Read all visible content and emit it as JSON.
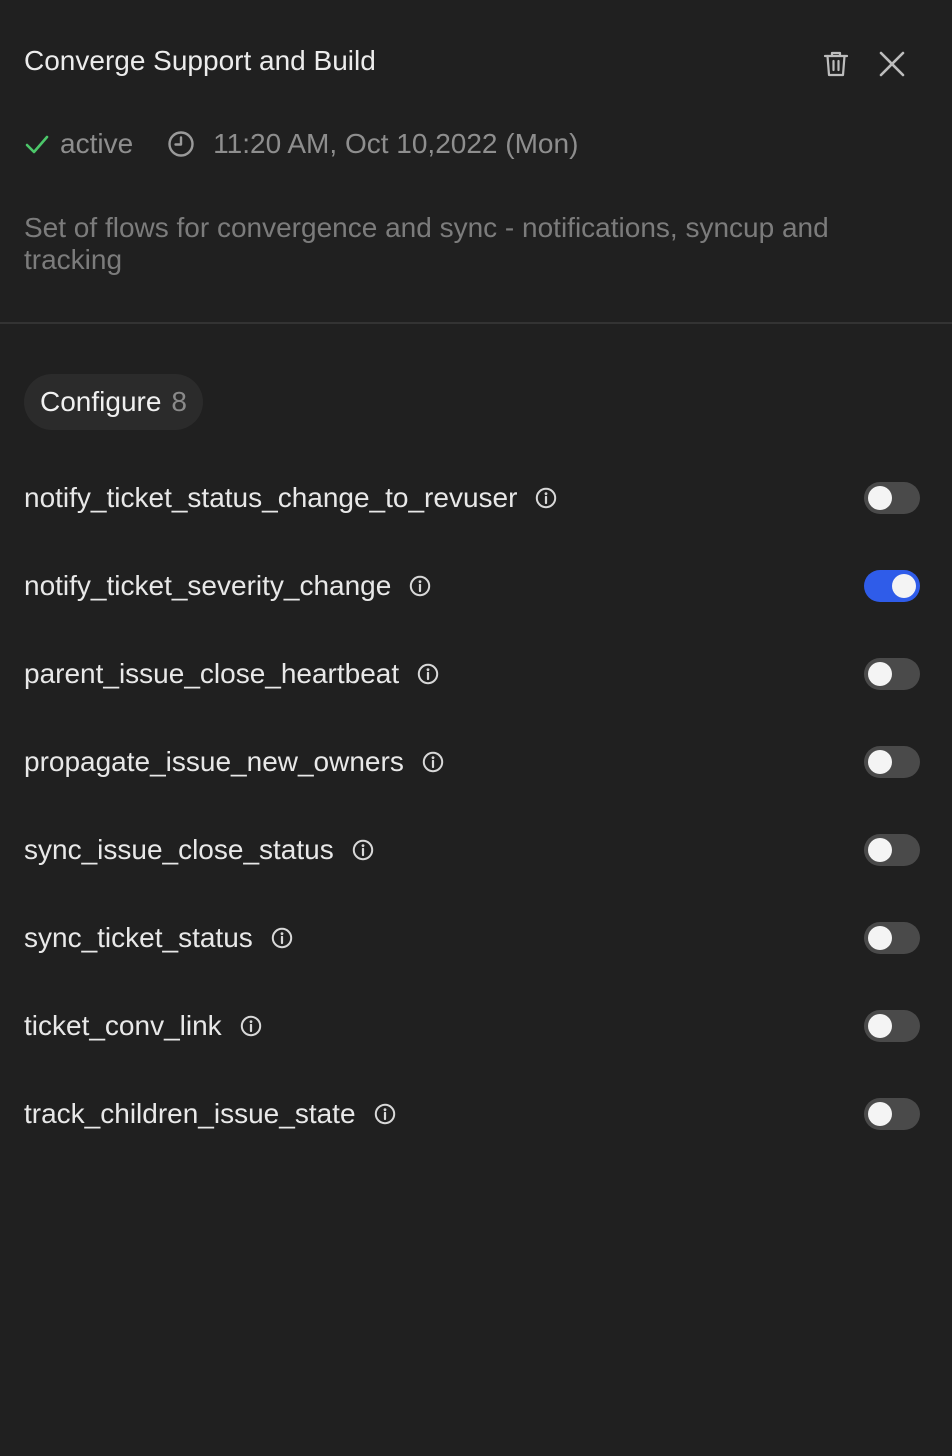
{
  "panel": {
    "title": "Converge Support and Build",
    "status": "active",
    "timestamp": "11:20 AM, Oct 10,2022 (Mon)",
    "description": "Set of flows for convergence and sync - notifications, syncup and tracking"
  },
  "icons": {
    "delete": "trash-icon",
    "close": "close-icon",
    "status": "check-icon",
    "time": "clock-icon",
    "info": "info-icon"
  },
  "colors": {
    "status_ok": "#4cc76a",
    "toggle_on": "#2f5ce9",
    "toggle_off": "#4a4a4a"
  },
  "configure": {
    "label": "Configure",
    "count": "8"
  },
  "flows": [
    {
      "name": "notify_ticket_status_change_to_revuser",
      "enabled": false
    },
    {
      "name": "notify_ticket_severity_change",
      "enabled": true
    },
    {
      "name": "parent_issue_close_heartbeat",
      "enabled": false
    },
    {
      "name": "propagate_issue_new_owners",
      "enabled": false
    },
    {
      "name": "sync_issue_close_status",
      "enabled": false
    },
    {
      "name": "sync_ticket_status",
      "enabled": false
    },
    {
      "name": "ticket_conv_link",
      "enabled": false
    },
    {
      "name": "track_children_issue_state",
      "enabled": false
    }
  ]
}
